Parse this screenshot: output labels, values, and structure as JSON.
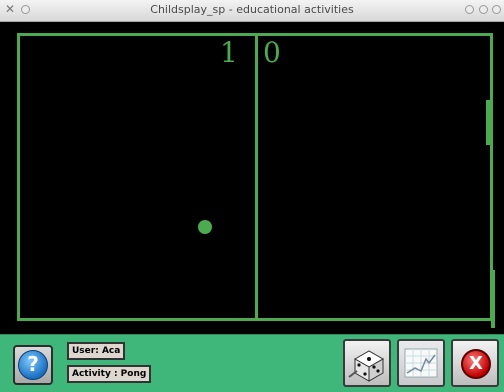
{
  "window": {
    "title": "Childsplay_sp - educational activities",
    "close_glyph": "✕"
  },
  "game": {
    "score_left": "1",
    "score_right": "0",
    "line_color": "#4caa4f",
    "background_color": "#000000"
  },
  "bottombar": {
    "background_color": "#3fb77a",
    "help_glyph": "?",
    "user_label": "User: Aca",
    "activity_label": "Activity : Pong",
    "quit_glyph": "X"
  }
}
